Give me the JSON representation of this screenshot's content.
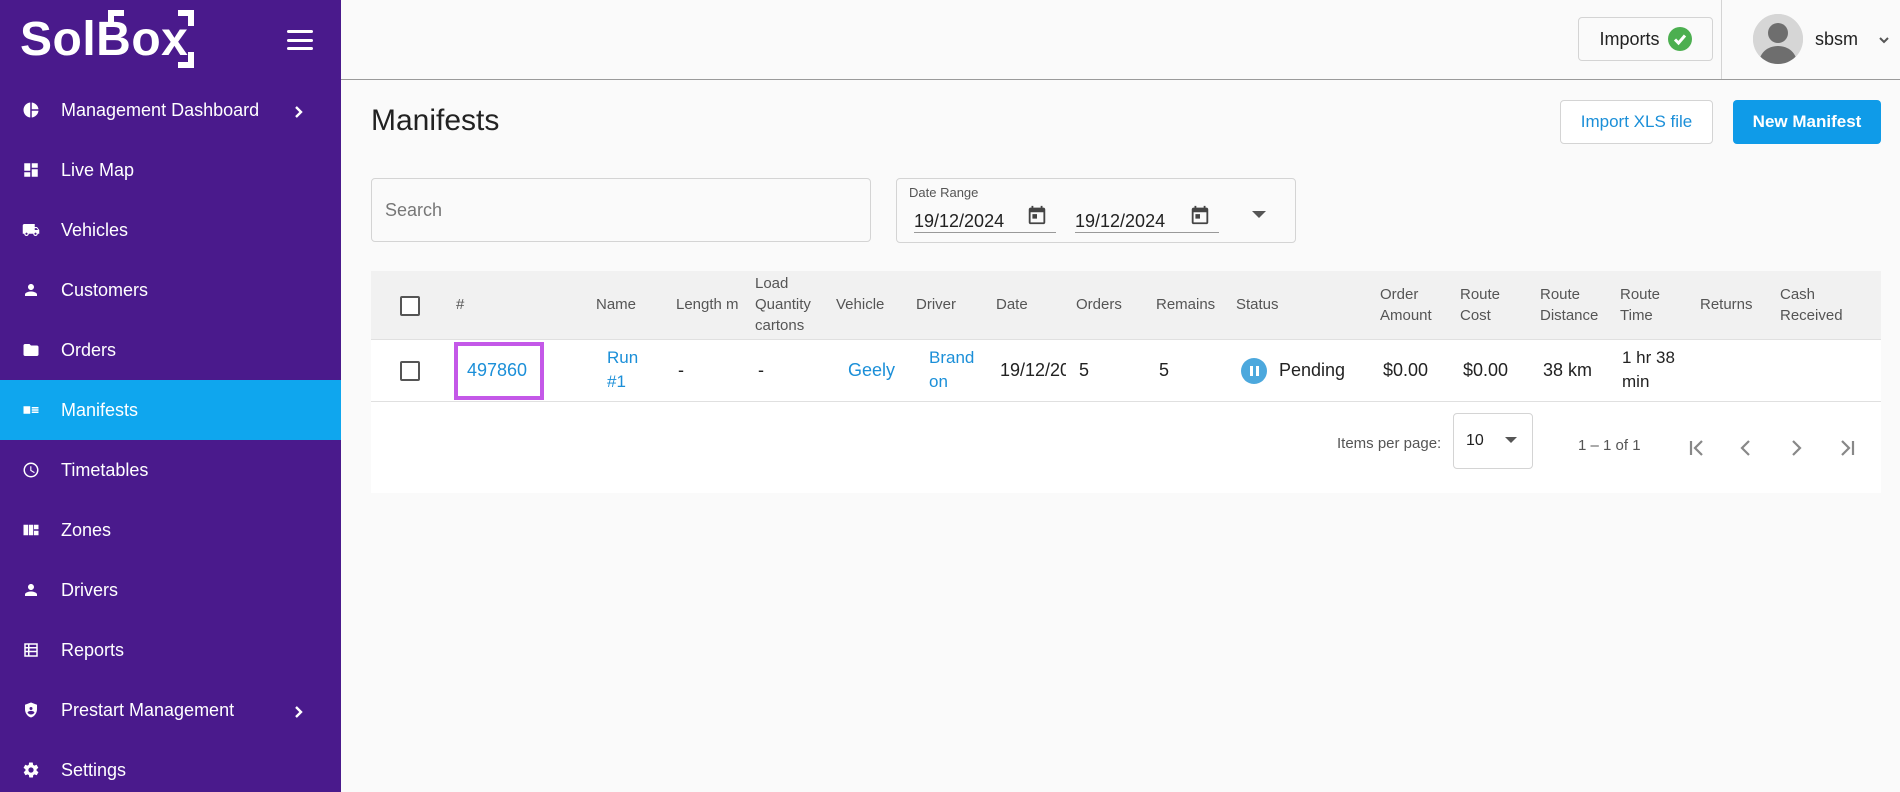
{
  "brand": {
    "name": "SolBox"
  },
  "sidebar": {
    "items": [
      {
        "label": "Management Dashboard",
        "icon": "pie-chart-icon",
        "has_chevron": true
      },
      {
        "label": "Live Map",
        "icon": "dashboard-icon"
      },
      {
        "label": "Vehicles",
        "icon": "truck-icon"
      },
      {
        "label": "Customers",
        "icon": "person-icon"
      },
      {
        "label": "Orders",
        "icon": "folder-icon"
      },
      {
        "label": "Manifests",
        "icon": "manifest-icon",
        "active": true
      },
      {
        "label": "Timetables",
        "icon": "clock-icon"
      },
      {
        "label": "Zones",
        "icon": "zones-icon"
      },
      {
        "label": "Drivers",
        "icon": "person-icon"
      },
      {
        "label": "Reports",
        "icon": "table-icon"
      },
      {
        "label": "Prestart Management",
        "icon": "shield-icon",
        "has_chevron": true
      },
      {
        "label": "Settings",
        "icon": "gear-icon"
      }
    ]
  },
  "topbar": {
    "imports_label": "Imports",
    "user_name": "sbsm"
  },
  "main": {
    "title": "Manifests",
    "import_button": "Import XLS file",
    "new_button": "New Manifest",
    "search_placeholder": "Search",
    "date_range": {
      "label": "Date Range",
      "start": "19/12/2024",
      "end": "19/12/2024"
    }
  },
  "table": {
    "headers": {
      "id": "#",
      "name": "Name",
      "length": "Length m",
      "load": [
        "Load",
        "Quantity",
        "cartons"
      ],
      "vehicle": "Vehicle",
      "driver": "Driver",
      "date": "Date",
      "orders": "Orders",
      "remains": "Remains",
      "status": "Status",
      "order_amount": [
        "Order",
        "Amount"
      ],
      "route_cost": [
        "Route",
        "Cost"
      ],
      "route_distance": [
        "Route",
        "Distance"
      ],
      "route_time": [
        "Route",
        "Time"
      ],
      "returns": "Returns",
      "cash_received": [
        "Cash",
        "Received"
      ]
    },
    "rows": [
      {
        "id": "497860",
        "name": [
          "Run",
          "#1"
        ],
        "length": "-",
        "load": "-",
        "vehicle": "Geely",
        "driver": [
          "Brand",
          "on"
        ],
        "date": "19/12/20",
        "orders": "5",
        "remains": "5",
        "status": "Pending",
        "order_amount": "$0.00",
        "route_cost": "$0.00",
        "route_distance": "38 km",
        "route_time": [
          "1 hr 38",
          "min"
        ],
        "returns": "",
        "cash_received": ""
      }
    ]
  },
  "paginator": {
    "items_per_page_label": "Items per page:",
    "page_size": "10",
    "range_label": "1 – 1 of 1"
  },
  "colors": {
    "sidebar_bg": "#4a1a8c",
    "active_item": "#0fa6ee",
    "primary_button": "#0f9be8",
    "link": "#1b8fd8",
    "highlight": "#c458e8",
    "status_pending": "#4ca8dd",
    "imports_ok": "#4caf50"
  }
}
